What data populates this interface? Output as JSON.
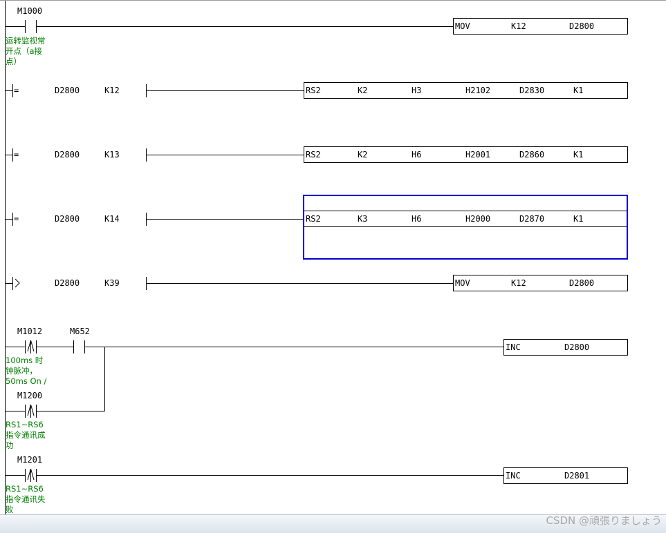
{
  "rungs": [
    {
      "contact": {
        "type": "NO",
        "device": "M1000"
      },
      "comment": "运转监视常\n开点（a接\n点）",
      "instruction": [
        "MOV",
        "K12",
        "D2800"
      ]
    },
    {
      "compare": {
        "op": "=",
        "s1": "D2800",
        "s2": "K12"
      },
      "instruction": [
        "RS2",
        "K2",
        "H3",
        "H2102",
        "D2830",
        "K1"
      ]
    },
    {
      "compare": {
        "op": "=",
        "s1": "D2800",
        "s2": "K13"
      },
      "instruction": [
        "RS2",
        "K2",
        "H6",
        "H2001",
        "D2860",
        "K1"
      ]
    },
    {
      "compare": {
        "op": "=",
        "s1": "D2800",
        "s2": "K14"
      },
      "instruction": [
        "RS2",
        "K3",
        "H6",
        "H2000",
        "D2870",
        "K1"
      ],
      "selected": true
    },
    {
      "compare": {
        "op": ">",
        "s1": "D2800",
        "s2": "K39"
      },
      "instruction": [
        "MOV",
        "K12",
        "D2800"
      ]
    },
    {
      "contacts": [
        {
          "type": "rising",
          "device": "M1012",
          "comment": "100ms 时\n钟脉冲，\n50ms On /"
        },
        {
          "type": "NO",
          "device": "M652"
        },
        {
          "type": "rising",
          "device": "M1200",
          "comment": "RS1~RS6\n指令通讯成\n功"
        }
      ],
      "instruction": [
        "INC",
        "D2800"
      ]
    },
    {
      "contact": {
        "type": "rising",
        "device": "M1201"
      },
      "comment": "RS1~RS6\n指令通讯失\n败",
      "instruction": [
        "INC",
        "D2801"
      ]
    }
  ],
  "watermark": "CSDN @頑張りましょう"
}
